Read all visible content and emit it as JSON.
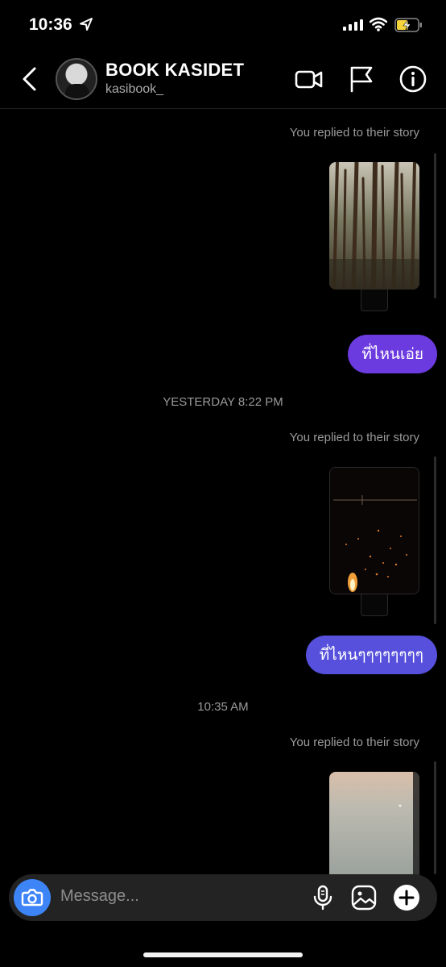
{
  "status_bar": {
    "time": "10:36"
  },
  "header": {
    "name": "BOOK KASIDET",
    "handle": "kasibook_"
  },
  "thread": {
    "story_reply_label_1": "You replied to their story",
    "message_1": "ที่ไหนเอ่ย",
    "divider_1": "YESTERDAY 8:22 PM",
    "story_reply_label_2": "You replied to their story",
    "message_2": "ที่ไหนๆๆๆๆๆๆๆๆ",
    "divider_2": "10:35 AM",
    "story_reply_label_3": "You replied to their story"
  },
  "composer": {
    "placeholder": "Message..."
  },
  "colors": {
    "bubble_1": "#6c3bdf",
    "bubble_2": "#5650dc",
    "camera": "#3d84f6",
    "background": "#000000"
  },
  "icons": [
    "location-arrow-icon",
    "signal-icon",
    "wifi-icon",
    "battery-charging-icon",
    "back-chevron-icon",
    "video-call-icon",
    "flag-icon",
    "info-icon",
    "camera-icon",
    "microphone-icon",
    "gallery-icon",
    "add-icon"
  ]
}
